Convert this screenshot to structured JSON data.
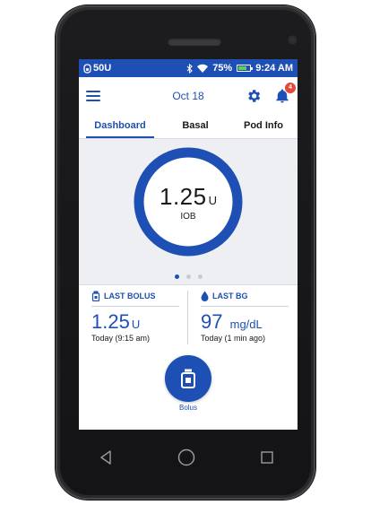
{
  "status_bar": {
    "reservoir": "50U",
    "battery_percent": "75%",
    "battery_level": 0.75,
    "time": "9:24 AM"
  },
  "header": {
    "date": "Oct 18",
    "notification_count": "4"
  },
  "tabs": [
    {
      "label": "Dashboard",
      "active": true
    },
    {
      "label": "Basal",
      "active": false
    },
    {
      "label": "Pod Info",
      "active": false
    }
  ],
  "iob": {
    "value": "1.25",
    "unit": "U",
    "label": "IOB",
    "ring_fill": 1.0
  },
  "pagination": {
    "pages": 3,
    "current": 1
  },
  "last_bolus": {
    "title": "LAST BOLUS",
    "value": "1.25",
    "unit": "U",
    "time": "Today (9:15 am)"
  },
  "last_bg": {
    "title": "LAST BG",
    "value": "97",
    "unit": "mg/dL",
    "time": "Today (1 min ago)"
  },
  "bolus_button": {
    "label": "Bolus"
  },
  "colors": {
    "accent": "#1e4fb4",
    "badge": "#e8473c",
    "panel": "#eeeff2"
  }
}
